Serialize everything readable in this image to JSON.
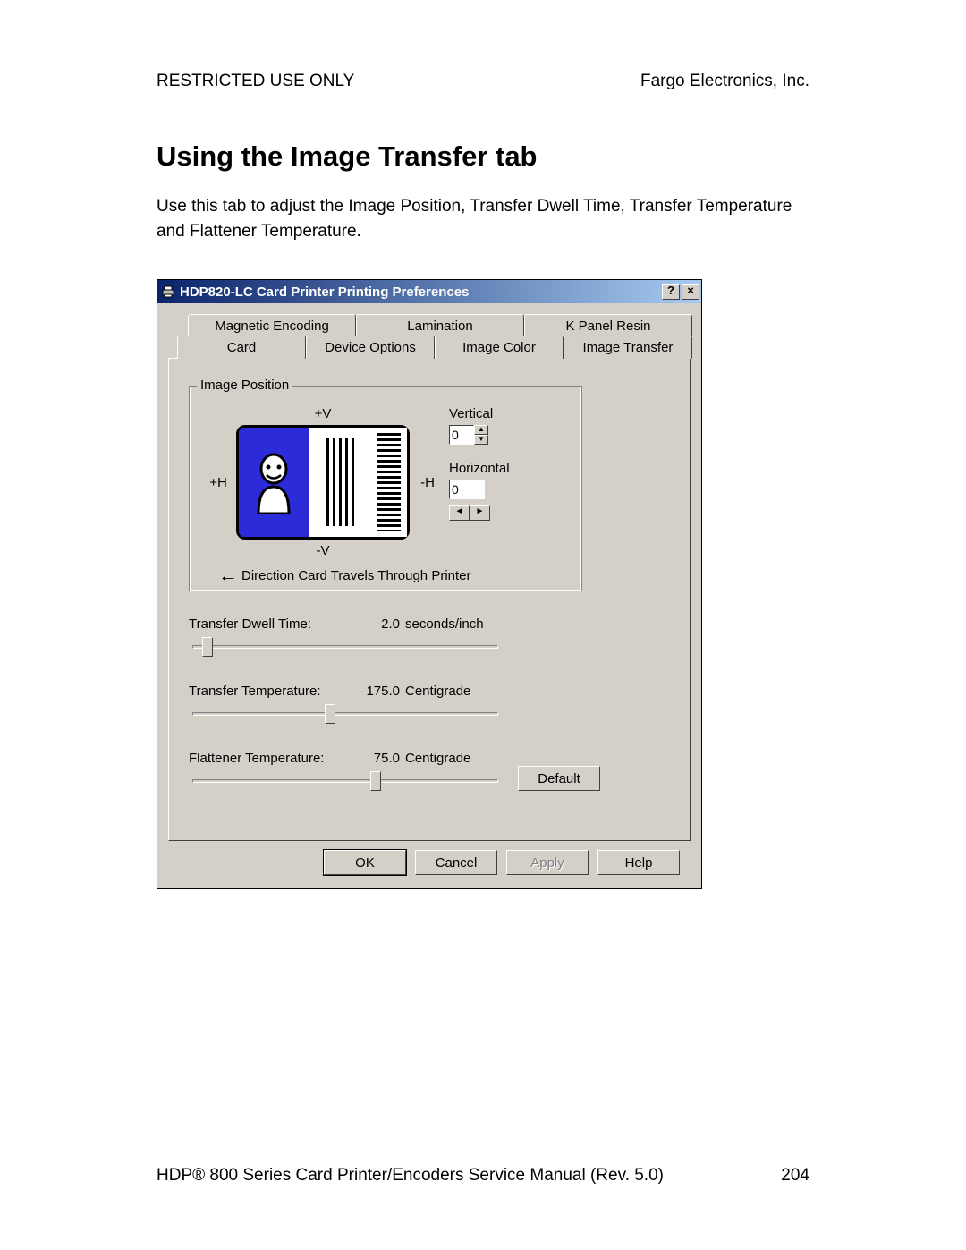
{
  "header": {
    "left": "RESTRICTED USE ONLY",
    "right": "Fargo Electronics, Inc."
  },
  "title": "Using the Image Transfer tab",
  "body": "Use this tab to adjust the Image Position, Transfer Dwell Time, Transfer Temperature and Flattener Temperature.",
  "dialog": {
    "title": "HDP820-LC Card Printer Printing Preferences",
    "help_btn": "?",
    "close_btn": "×",
    "tabs_row1": [
      "Magnetic Encoding",
      "Lamination",
      "K Panel Resin"
    ],
    "tabs_row2": [
      "Card",
      "Device Options",
      "Image Color",
      "Image Transfer"
    ],
    "active_tab": "Image Transfer",
    "image_position": {
      "legend": "Image Position",
      "plus_v": "+V",
      "minus_v": "-V",
      "plus_h": "+H",
      "minus_h": "-H",
      "vertical_label": "Vertical",
      "vertical_value": "0",
      "horizontal_label": "Horizontal",
      "horizontal_value": "0",
      "direction_text": "Direction Card Travels Through Printer"
    },
    "sliders": {
      "dwell": {
        "label": "Transfer Dwell Time:",
        "value": "2.0",
        "unit": "seconds/inch",
        "pos_pct": 5
      },
      "temp": {
        "label": "Transfer Temperature:",
        "value": "175.0",
        "unit": "Centigrade",
        "pos_pct": 45
      },
      "flattener": {
        "label": "Flattener Temperature:",
        "value": "75.0",
        "unit": "Centigrade",
        "pos_pct": 60
      }
    },
    "default_btn": "Default",
    "buttons": {
      "ok": "OK",
      "cancel": "Cancel",
      "apply": "Apply",
      "help": "Help"
    }
  },
  "footer": {
    "left": "HDP® 800 Series Card Printer/Encoders Service Manual (Rev. 5.0)",
    "right": "204"
  }
}
